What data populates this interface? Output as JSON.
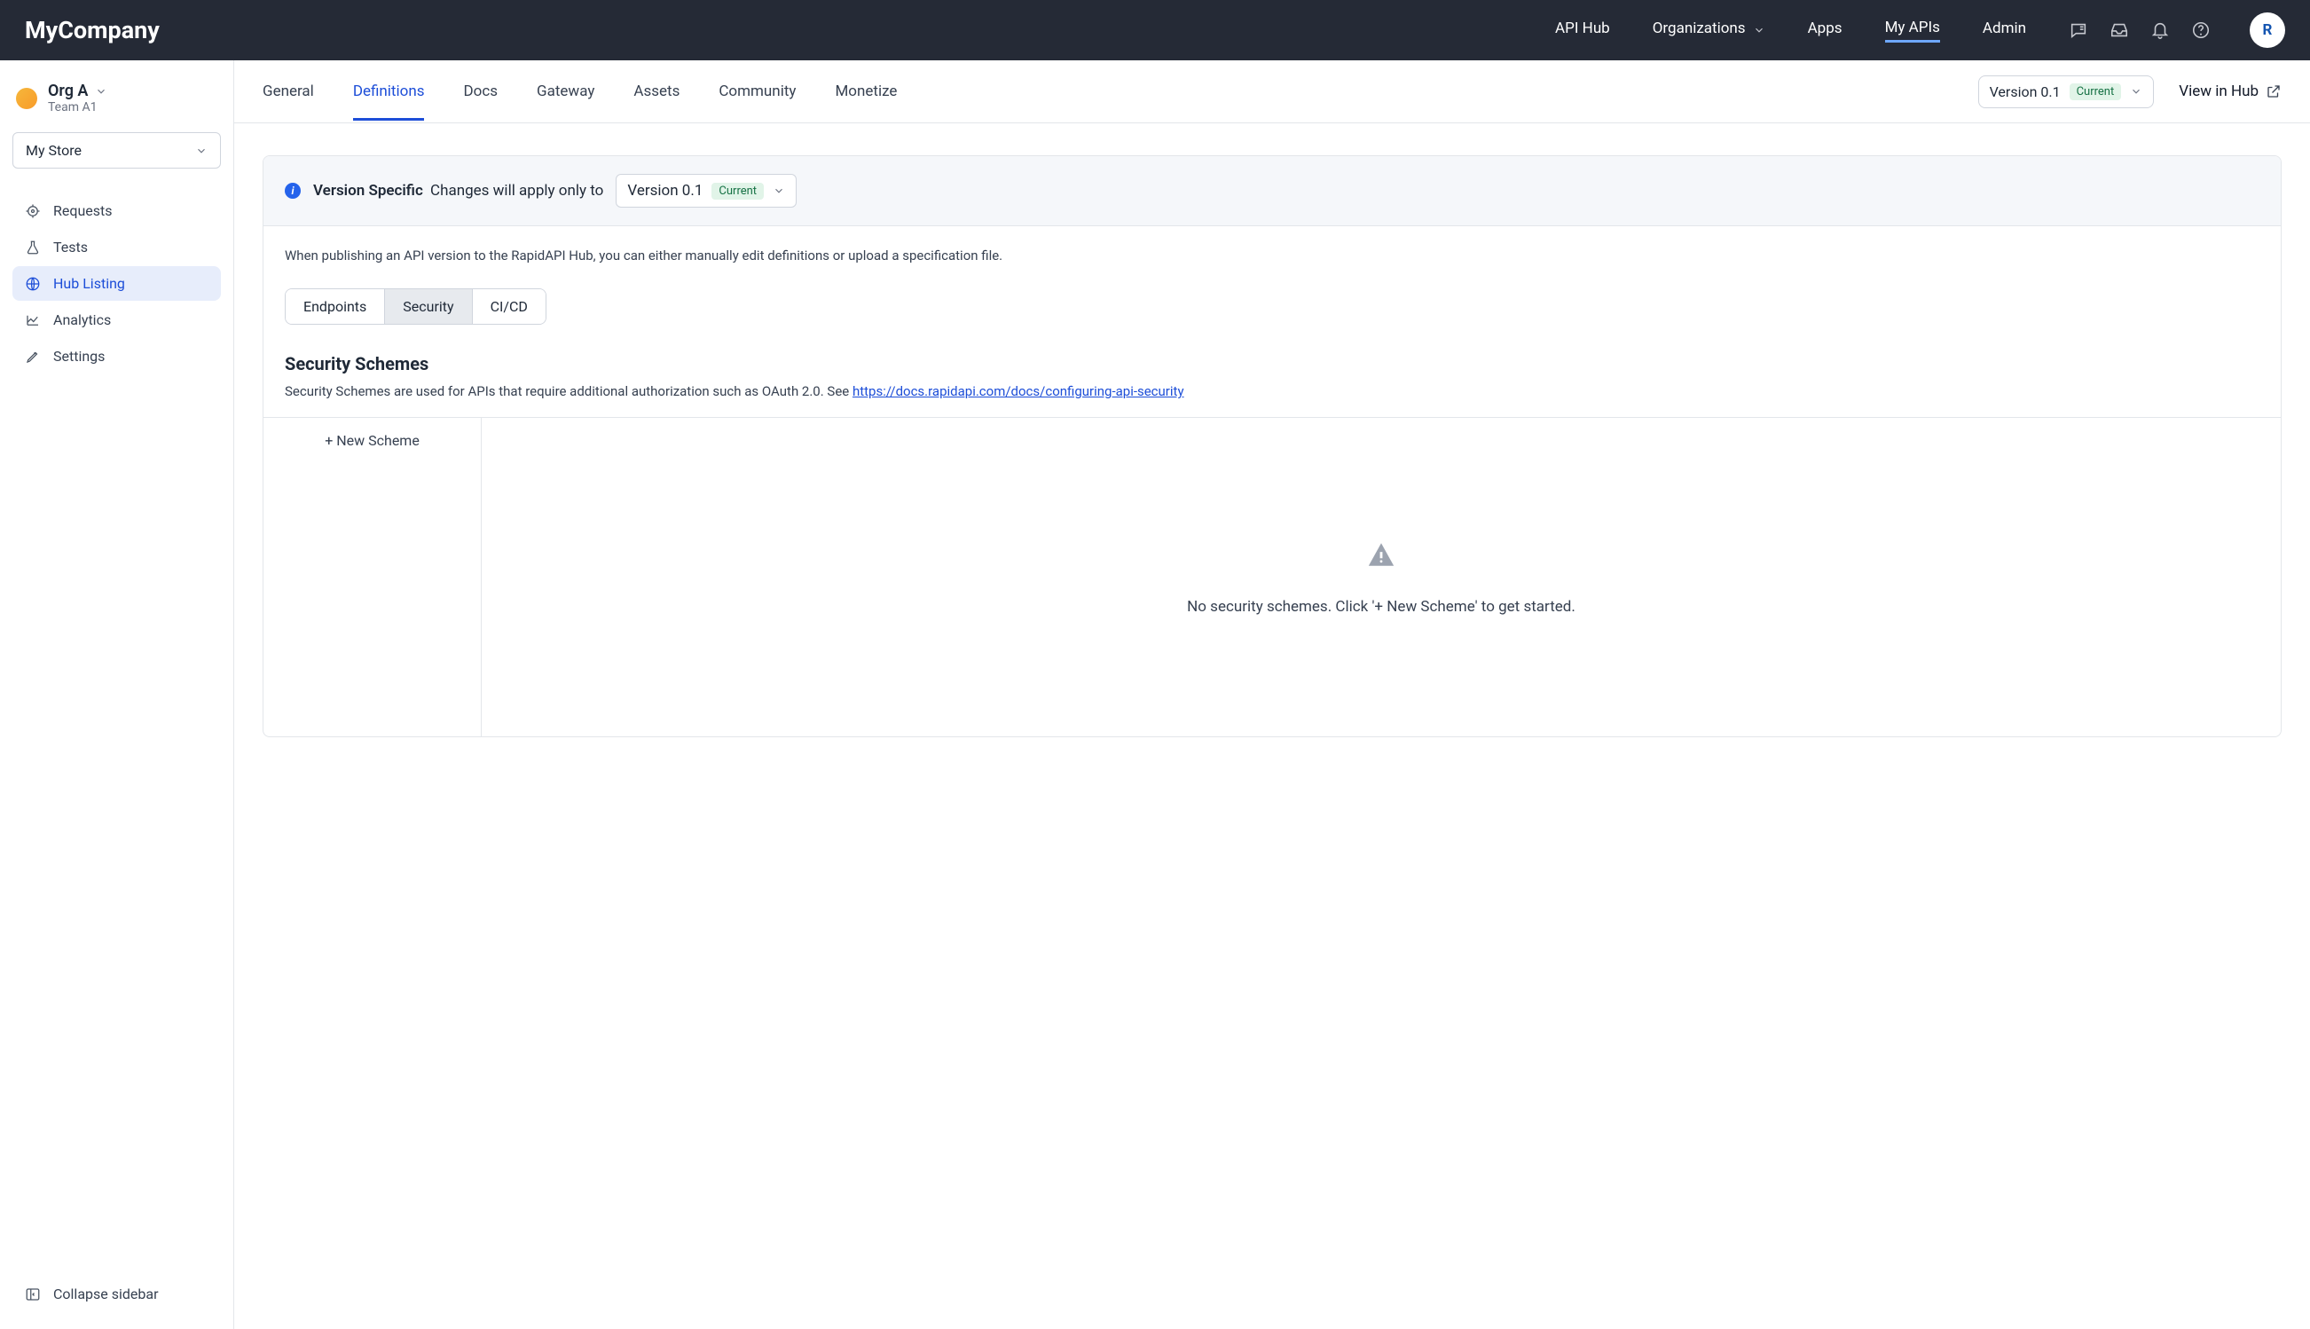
{
  "header": {
    "brand": "MyCompany",
    "nav": [
      "API Hub",
      "Organizations",
      "Apps",
      "My APIs",
      "Admin"
    ],
    "avatar_initial": "R"
  },
  "sidebar": {
    "org_name": "Org A",
    "org_team": "Team A1",
    "store_select": "My Store",
    "items": [
      {
        "label": "Requests"
      },
      {
        "label": "Tests"
      },
      {
        "label": "Hub Listing"
      },
      {
        "label": "Analytics"
      },
      {
        "label": "Settings"
      }
    ],
    "collapse": "Collapse sidebar"
  },
  "tabbar": {
    "tabs": [
      "General",
      "Definitions",
      "Docs",
      "Gateway",
      "Assets",
      "Community",
      "Monetize"
    ],
    "version_label": "Version 0.1",
    "current_label": "Current",
    "view_in_hub": "View in Hub"
  },
  "notice": {
    "strong": "Version Specific",
    "text": "Changes will apply only to",
    "version_label": "Version 0.1",
    "current_label": "Current"
  },
  "body": {
    "desc": "When publishing an API version to the RapidAPI Hub, you can either manually edit definitions or upload a specification file.",
    "subtabs": [
      "Endpoints",
      "Security",
      "CI/CD"
    ]
  },
  "security": {
    "title": "Security Schemes",
    "desc_prefix": "Security Schemes are used for APIs that require additional authorization such as OAuth 2.0. See ",
    "desc_link": "https://docs.rapidapi.com/docs/configuring-api-security",
    "new_scheme": "+ New Scheme",
    "empty_text": "No security schemes. Click '+ New Scheme' to get started."
  }
}
